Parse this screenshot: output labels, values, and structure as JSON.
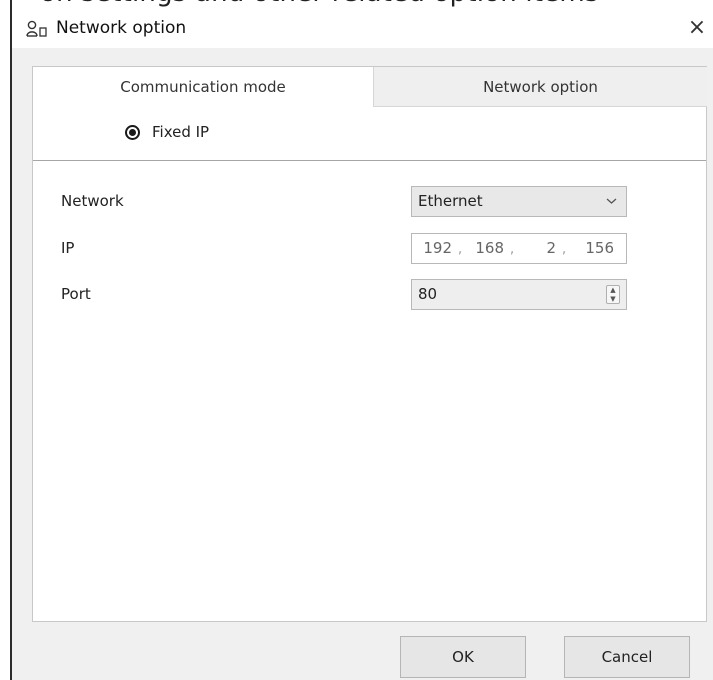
{
  "window": {
    "title": "Network option",
    "title_icon": "user-network-icon",
    "close_label": "×"
  },
  "tabs": [
    {
      "label": "Communication mode",
      "active": true
    },
    {
      "label": "Network option",
      "active": false
    }
  ],
  "communication": {
    "mode_label": "Fixed IP",
    "selected": true
  },
  "fields": {
    "network": {
      "label": "Network",
      "value": "Ethernet"
    },
    "ip": {
      "label": "IP",
      "octets": [
        "192",
        "168",
        "2",
        "156"
      ]
    },
    "port": {
      "label": "Port",
      "value": "80"
    }
  },
  "buttons": {
    "ok": "OK",
    "cancel": "Cancel"
  },
  "colors": {
    "dialog_bg": "#f0f0f0",
    "panel_bg": "#ffffff",
    "inactive_tab_bg": "#efefef"
  }
}
